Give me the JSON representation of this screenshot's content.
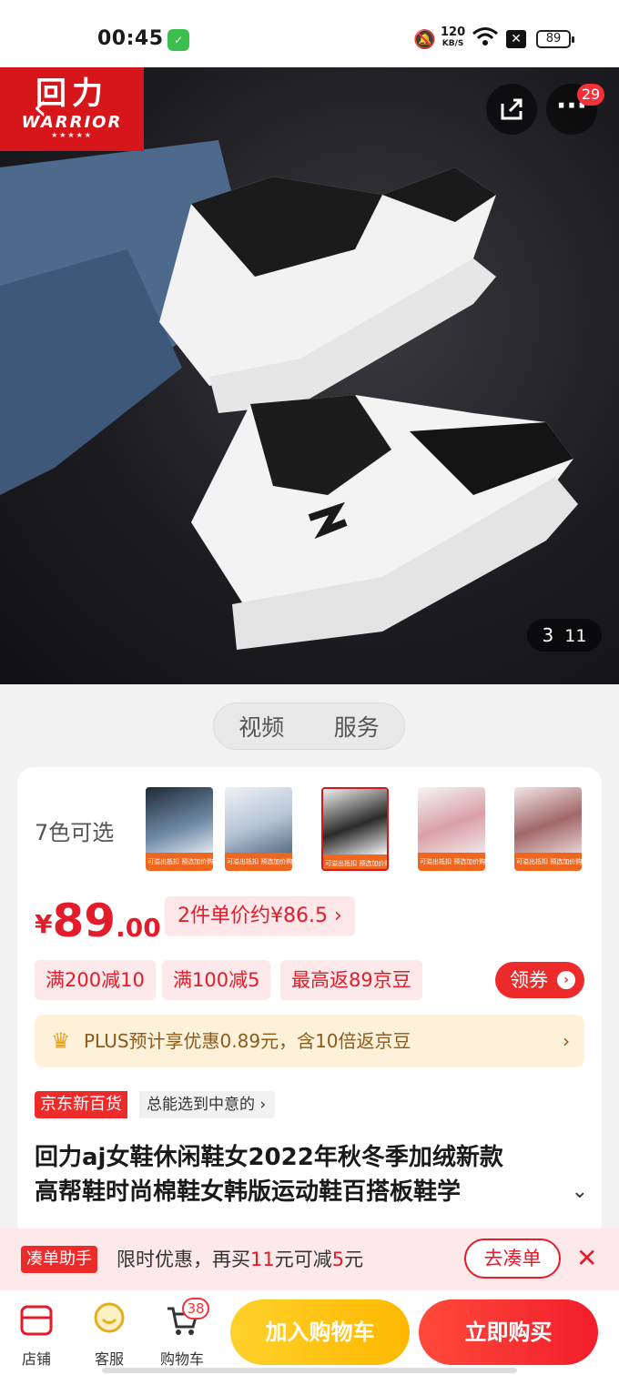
{
  "status": {
    "time": "00:45",
    "net_speed": "120",
    "net_unit": "KB/S",
    "battery": "89"
  },
  "header": {
    "logo_cn": "回力",
    "logo_en": "WARRIOR",
    "more_badge": "29",
    "image_index": "3",
    "image_total": "11"
  },
  "media_tabs": [
    "视频",
    "服务"
  ],
  "colors": {
    "label": "7色可选",
    "thumb_banner": "可溢出抵扣 预选加价购 99",
    "thumb_colors": [
      "#6f8aa6",
      "#b7c5d6",
      "#2a2a2a",
      "#d9a0a6",
      "#a2676a"
    ],
    "selected_index": 2
  },
  "price": {
    "currency": "¥",
    "integer": "89",
    "decimal": ".00",
    "unit_price": "2件单价约¥86.5"
  },
  "tags": [
    "满200减10",
    "满100减5",
    "最高返89京豆"
  ],
  "coupon_label": "领券",
  "plus": {
    "text": "PLUS预计享优惠0.89元，含10倍返京豆",
    "chevron": "›"
  },
  "department": {
    "badge": "京东新百货",
    "slogan": "总能选到中意的"
  },
  "title": {
    "line1": "回力aj女鞋休闲鞋女2022年秋冬季加绒新款",
    "line2": "高帮鞋时尚棉鞋女韩版运动鞋百搭板鞋学"
  },
  "promo": {
    "helper": "凑单助手",
    "msg_prefix": "限时优惠，再买",
    "amount1": "11",
    "msg_mid": "元可减",
    "amount2": "5",
    "msg_suffix": "元",
    "action": "去凑单"
  },
  "bottom_nav": {
    "shop": "店铺",
    "service": "客服",
    "cart": "购物车",
    "cart_count": "38"
  },
  "actions": {
    "add_to_cart": "加入购物车",
    "buy_now": "立即购买"
  },
  "theme": {
    "accent_red": "#e21c2b",
    "gold": "#ffc21a"
  }
}
